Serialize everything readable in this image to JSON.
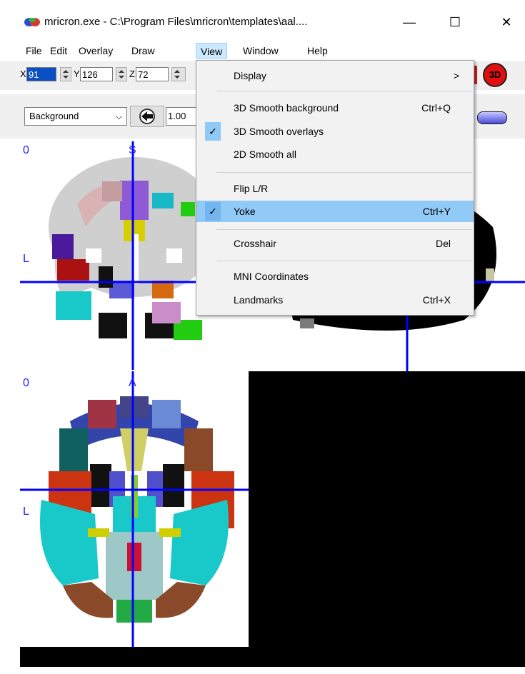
{
  "window": {
    "title": "mricron.exe - C:\\Program Files\\mricron\\templates\\aal....",
    "min": "—",
    "max": "☐",
    "close": "✕"
  },
  "menubar": [
    "File",
    "Edit",
    "Overlay",
    "Draw",
    "View",
    "Window",
    "Help"
  ],
  "toolbar": {
    "x_label": "X",
    "x_value": "91",
    "y_label": "Y",
    "y_value": "126",
    "z_label": "Z",
    "z_value": "72",
    "layer_select": "Background",
    "contrast_value": "1.00",
    "render_button": "3D"
  },
  "viewer": {
    "coronal_origin": "0",
    "coronal_top": "S",
    "coronal_left": "L",
    "axial_origin": "0",
    "axial_top": "A",
    "axial_left": "L"
  },
  "view_menu": {
    "items": [
      {
        "label": "Display",
        "accel": "",
        "submenu": ">"
      },
      {
        "label": "3D Smooth background",
        "accel": "Ctrl+Q"
      },
      {
        "label": "3D Smooth overlays",
        "accel": "",
        "checked": "✓"
      },
      {
        "label": "2D Smooth all",
        "accel": ""
      },
      {
        "label": "Flip L/R",
        "accel": ""
      },
      {
        "label": "Yoke",
        "accel": "Ctrl+Y",
        "checked": "✓"
      },
      {
        "label": "Crosshair",
        "accel": "Del"
      },
      {
        "label": "MNI Coordinates",
        "accel": ""
      },
      {
        "label": "Landmarks",
        "accel": "Ctrl+X"
      }
    ]
  },
  "colors": {
    "crosshair": "#0000ff",
    "highlight": "#91c9f7",
    "menu_bg": "#f2f2f2"
  }
}
